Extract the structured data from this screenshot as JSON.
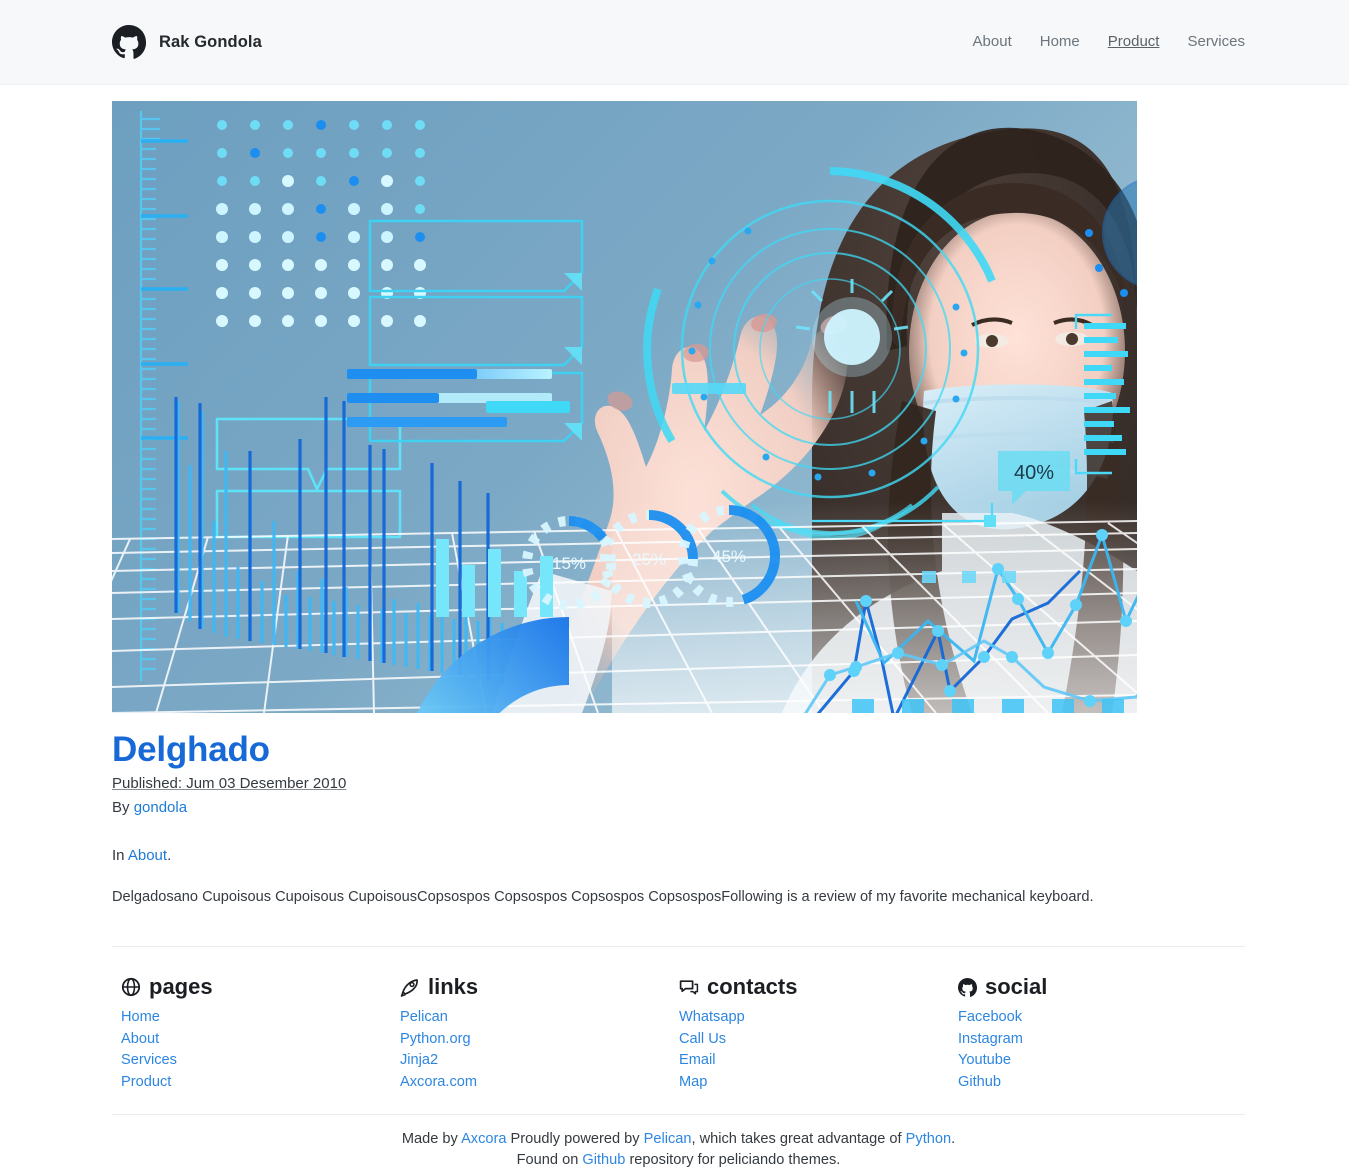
{
  "header": {
    "brand_icon": "github-octocat-icon",
    "brand_name": "Rak Gondola",
    "nav": [
      {
        "label": "About",
        "active": false
      },
      {
        "label": "Home",
        "active": false
      },
      {
        "label": "Product",
        "active": true
      },
      {
        "label": "Services",
        "active": false
      }
    ]
  },
  "hero": {
    "alt": "Futuristic HUD dashboard with woman in surgical mask touching a glowing circular interface",
    "gauges": [
      "15%",
      "25%",
      "45%"
    ],
    "tooltip_badge": "40%",
    "colors": {
      "background": "#6d9fc0",
      "cyan": "#49e0f5",
      "blue": "#1f8ef1",
      "deep_blue": "#0b5fd0",
      "grid": "#ffffff"
    }
  },
  "post": {
    "title": "Delghado",
    "published_label": "Published: Jum 03 Desember 2010",
    "by_label": "By",
    "author": "gondola",
    "in_label": "In",
    "category": "About",
    "period": ".",
    "body": "Delgadosano Cupoisous Cupoisous CupoisousCopsospos Copsospos Copsospos CopsosposFollowing is a review of my favorite mechanical keyboard."
  },
  "footer": {
    "columns": [
      {
        "icon": "globe-icon",
        "title": "pages",
        "links": [
          "Home",
          "About",
          "Services",
          "Product"
        ]
      },
      {
        "icon": "rocket-icon",
        "title": "links",
        "links": [
          "Pelican",
          "Python.org",
          "Jinja2",
          "Axcora.com"
        ]
      },
      {
        "icon": "chat-bubble-icon",
        "title": "contacts",
        "links": [
          "Whatsapp",
          "Call Us",
          "Email",
          "Map"
        ]
      },
      {
        "icon": "github-icon",
        "title": "social",
        "links": [
          "Facebook",
          "Instagram",
          "Youtube",
          "Github"
        ]
      }
    ],
    "colophon": {
      "made_by_label": "Made by",
      "made_by_link": "Axcora",
      "powered_label": "Proudly powered by",
      "powered_link": "Pelican",
      "advantage_label": ", which takes great advantage of",
      "advantage_link": "Python",
      "advantage_end": ".",
      "found_label": "Found on",
      "found_link": "Github",
      "found_end": "repository for peliciando themes."
    }
  }
}
